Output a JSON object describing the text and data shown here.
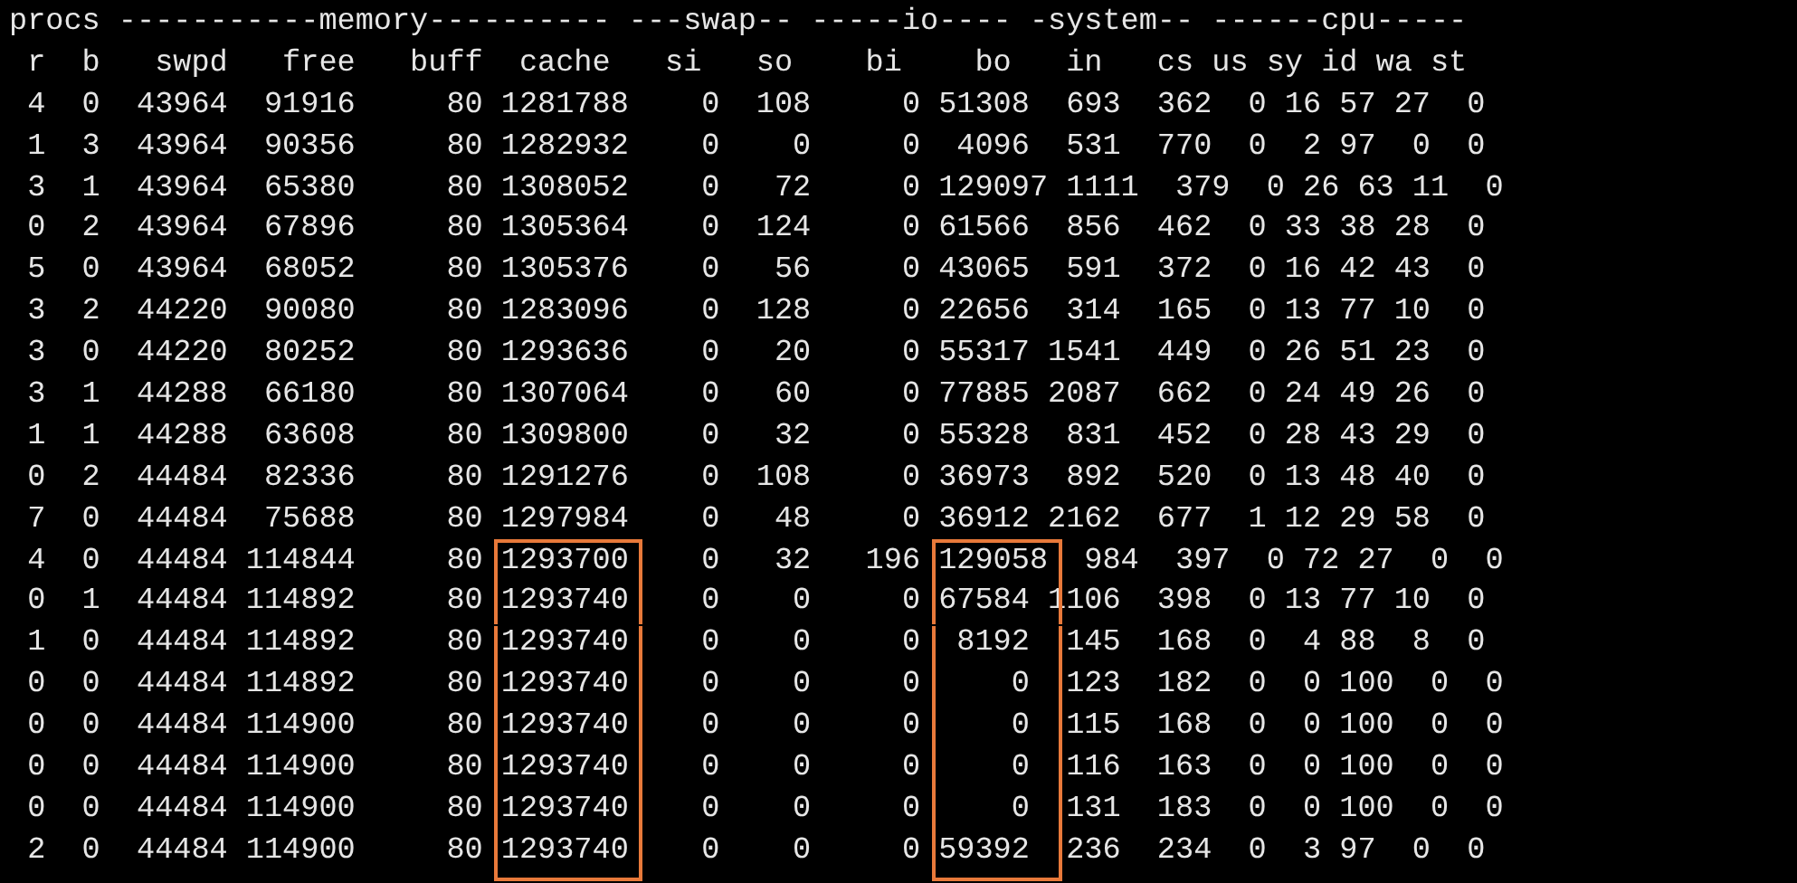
{
  "group_header": "procs -----------memory---------- ---swap-- -----io---- -system-- ------cpu-----",
  "columns": [
    "r",
    "b",
    "swpd",
    "free",
    "buff",
    "cache",
    "si",
    "so",
    "bi",
    "bo",
    "in",
    "cs",
    "us",
    "sy",
    "id",
    "wa",
    "st"
  ],
  "rows": [
    {
      "values": [
        "4",
        "0",
        "43964",
        "91916",
        "80",
        "1281788",
        "0",
        "108",
        "0",
        "51308",
        "693",
        "362",
        "0",
        "16",
        "57",
        "27",
        "0"
      ]
    },
    {
      "values": [
        "1",
        "3",
        "43964",
        "90356",
        "80",
        "1282932",
        "0",
        "0",
        "0",
        "4096",
        "531",
        "770",
        "0",
        "2",
        "97",
        "0",
        "0"
      ]
    },
    {
      "values": [
        "3",
        "1",
        "43964",
        "65380",
        "80",
        "1308052",
        "0",
        "72",
        "0",
        "129097",
        "1111",
        "379",
        "0",
        "26",
        "63",
        "11",
        "0"
      ]
    },
    {
      "values": [
        "0",
        "2",
        "43964",
        "67896",
        "80",
        "1305364",
        "0",
        "124",
        "0",
        "61566",
        "856",
        "462",
        "0",
        "33",
        "38",
        "28",
        "0"
      ]
    },
    {
      "values": [
        "5",
        "0",
        "43964",
        "68052",
        "80",
        "1305376",
        "0",
        "56",
        "0",
        "43065",
        "591",
        "372",
        "0",
        "16",
        "42",
        "43",
        "0"
      ]
    },
    {
      "values": [
        "3",
        "2",
        "44220",
        "90080",
        "80",
        "1283096",
        "0",
        "128",
        "0",
        "22656",
        "314",
        "165",
        "0",
        "13",
        "77",
        "10",
        "0"
      ]
    },
    {
      "values": [
        "3",
        "0",
        "44220",
        "80252",
        "80",
        "1293636",
        "0",
        "20",
        "0",
        "55317",
        "1541",
        "449",
        "0",
        "26",
        "51",
        "23",
        "0"
      ]
    },
    {
      "values": [
        "3",
        "1",
        "44288",
        "66180",
        "80",
        "1307064",
        "0",
        "60",
        "0",
        "77885",
        "2087",
        "662",
        "0",
        "24",
        "49",
        "26",
        "0"
      ]
    },
    {
      "values": [
        "1",
        "1",
        "44288",
        "63608",
        "80",
        "1309800",
        "0",
        "32",
        "0",
        "55328",
        "831",
        "452",
        "0",
        "28",
        "43",
        "29",
        "0"
      ]
    },
    {
      "values": [
        "0",
        "2",
        "44484",
        "82336",
        "80",
        "1291276",
        "0",
        "108",
        "0",
        "36973",
        "892",
        "520",
        "0",
        "13",
        "48",
        "40",
        "0"
      ]
    },
    {
      "values": [
        "7",
        "0",
        "44484",
        "75688",
        "80",
        "1297984",
        "0",
        "48",
        "0",
        "36912",
        "2162",
        "677",
        "1",
        "12",
        "29",
        "58",
        "0"
      ]
    },
    {
      "values": [
        "4",
        "0",
        "44484",
        "114844",
        "80",
        {
          "text": "1293700",
          "boxed": true
        },
        "0",
        "32",
        "196",
        {
          "text": "129058",
          "boxed": true
        },
        "984",
        "397",
        "0",
        "72",
        "27",
        "0",
        "0"
      ]
    },
    {
      "values": [
        "0",
        "1",
        "44484",
        "114892",
        "80",
        {
          "text": "1293740",
          "boxed": true
        },
        "0",
        "0",
        "0",
        {
          "text": "67584",
          "boxed": true
        },
        "1106",
        "398",
        "0",
        "13",
        "77",
        "10",
        "0"
      ]
    },
    {
      "values": [
        "1",
        "0",
        "44484",
        "114892",
        "80",
        {
          "text": "1293740",
          "boxed": true
        },
        "0",
        "0",
        "0",
        {
          "text": "8192",
          "boxed": true
        },
        "145",
        "168",
        "0",
        "4",
        "88",
        "8",
        "0"
      ]
    },
    {
      "values": [
        "0",
        "0",
        "44484",
        "114892",
        "80",
        {
          "text": "1293740",
          "boxed": true
        },
        "0",
        "0",
        "0",
        {
          "text": "0",
          "boxed": true
        },
        "123",
        "182",
        "0",
        "0",
        "100",
        "0",
        "0"
      ]
    },
    {
      "values": [
        "0",
        "0",
        "44484",
        "114900",
        "80",
        {
          "text": "1293740",
          "boxed": true
        },
        "0",
        "0",
        "0",
        {
          "text": "0",
          "boxed": true
        },
        "115",
        "168",
        "0",
        "0",
        "100",
        "0",
        "0"
      ]
    },
    {
      "values": [
        "0",
        "0",
        "44484",
        "114900",
        "80",
        {
          "text": "1293740",
          "boxed": true
        },
        "0",
        "0",
        "0",
        {
          "text": "0",
          "boxed": true
        },
        "116",
        "163",
        "0",
        "0",
        "100",
        "0",
        "0"
      ]
    },
    {
      "values": [
        "0",
        "0",
        "44484",
        "114900",
        "80",
        {
          "text": "1293740",
          "boxed": true
        },
        "0",
        "0",
        "0",
        {
          "text": "0",
          "boxed": true
        },
        "131",
        "183",
        "0",
        "0",
        "100",
        "0",
        "0"
      ]
    },
    {
      "values": [
        "2",
        "0",
        "44484",
        "114900",
        "80",
        {
          "text": "1293740",
          "boxed": true
        },
        "0",
        "0",
        "0",
        {
          "text": "59392",
          "boxed": true
        },
        "236",
        "234",
        "0",
        "3",
        "97",
        "0",
        "0"
      ]
    }
  ]
}
